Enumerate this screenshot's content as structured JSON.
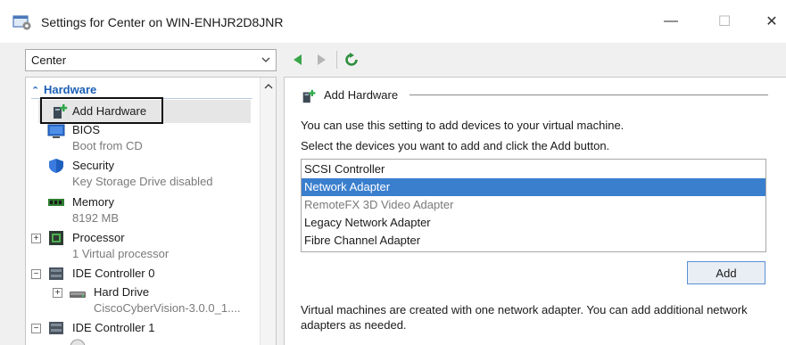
{
  "window": {
    "title": "Settings for Center on WIN-ENHJR2D8JNR",
    "minimize_glyph": "—",
    "maximize_glyph": "☐",
    "close_glyph": "✕"
  },
  "toolbar": {
    "vm_select_value": "Center",
    "icons": [
      "back-arrow-icon",
      "forward-arrow-icon",
      "refresh-icon"
    ]
  },
  "tree": {
    "section_header": "Hardware",
    "section_chevron": "⌃",
    "items": [
      {
        "label": "Add Hardware",
        "icon": "add-hardware-icon"
      },
      {
        "label": "BIOS",
        "sub": "Boot from CD",
        "icon": "bios-icon"
      },
      {
        "label": "Security",
        "sub": "Key Storage Drive disabled",
        "icon": "shield-icon"
      },
      {
        "label": "Memory",
        "sub": "8192 MB",
        "icon": "memory-icon"
      },
      {
        "label": "Processor",
        "sub": "1 Virtual processor",
        "icon": "processor-icon",
        "expander": "+"
      },
      {
        "label": "IDE Controller 0",
        "icon": "ide-controller-icon",
        "expander": "−"
      },
      {
        "label": "Hard Drive",
        "sub": "CiscoCyberVision-3.0.0_1....",
        "icon": "hard-drive-icon",
        "expander": "+"
      },
      {
        "label": "IDE Controller 1",
        "icon": "ide-controller-icon",
        "expander": "−"
      }
    ]
  },
  "details": {
    "section_title": "Add Hardware",
    "description_1": "You can use this setting to add devices to your virtual machine.",
    "description_2": "Select the devices you want to add and click the Add button.",
    "devices": [
      {
        "label": "SCSI Controller",
        "state": "normal"
      },
      {
        "label": "Network Adapter",
        "state": "selected"
      },
      {
        "label": "RemoteFX 3D Video Adapter",
        "state": "disabled"
      },
      {
        "label": "Legacy Network Adapter",
        "state": "normal"
      },
      {
        "label": "Fibre Channel Adapter",
        "state": "normal"
      }
    ],
    "add_button_label": "Add",
    "footer_note": "Virtual machines are created with one network adapter. You can add additional network adapters as needed."
  },
  "colors": {
    "accent": "#1a5fb4",
    "selection": "#3a7fce",
    "nav_green": "#3aa64a"
  }
}
